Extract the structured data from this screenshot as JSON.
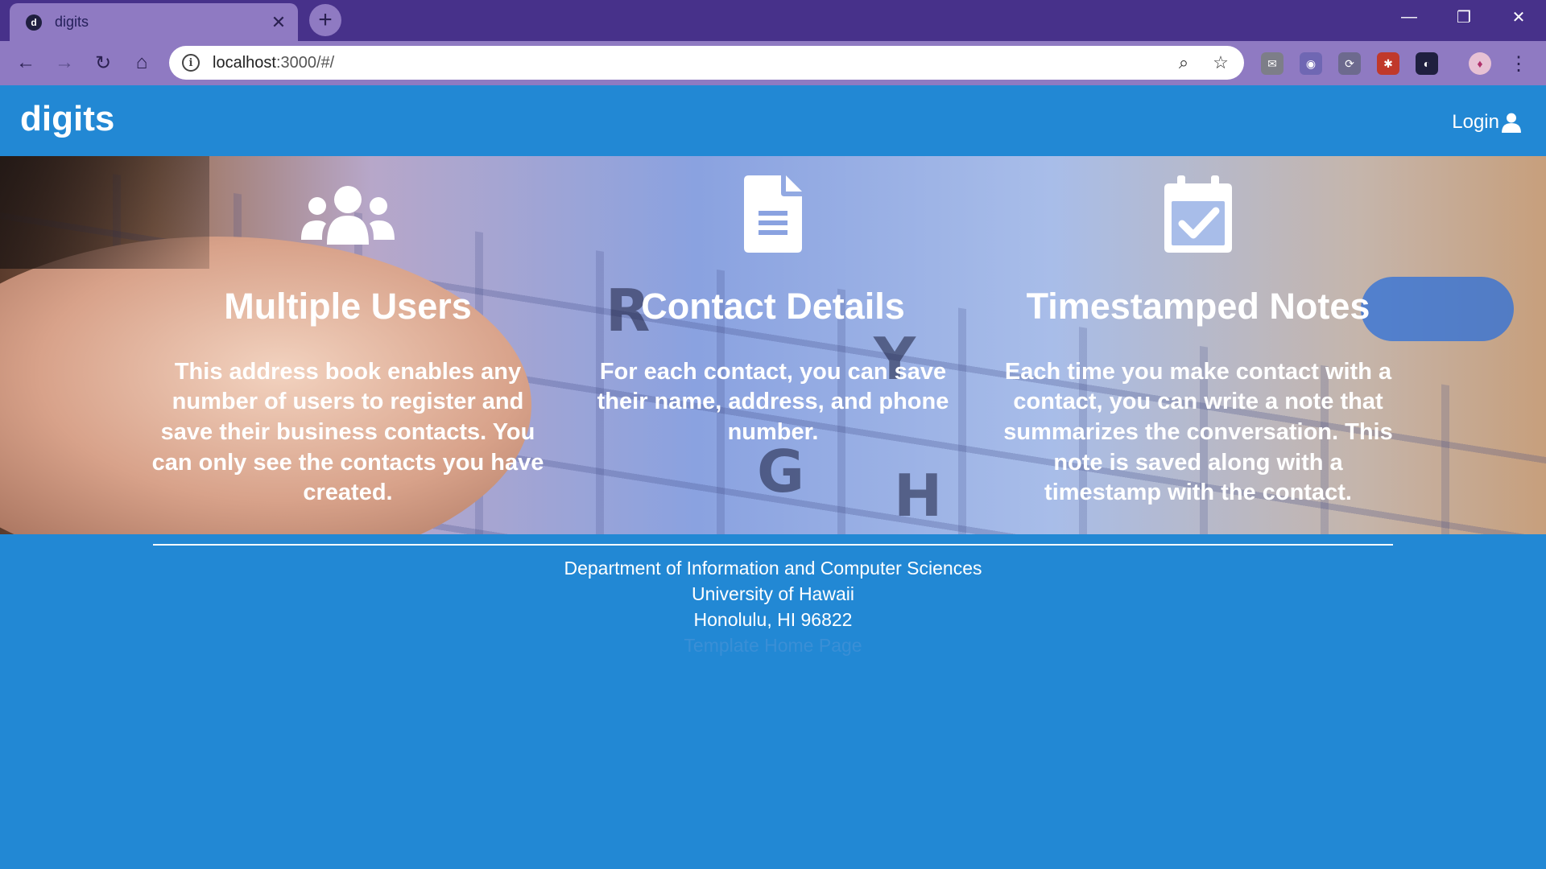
{
  "browser": {
    "tab_title": "digits",
    "url_host": "localhost",
    "url_path": ":3000/#/"
  },
  "navbar": {
    "brand": "digits",
    "login_label": "Login"
  },
  "features": [
    {
      "icon": "users-icon",
      "title": "Multiple Users",
      "description": "This address book enables any number of users to register and save their business contacts. You can only see the contacts you have created."
    },
    {
      "icon": "file-icon",
      "title": "Contact Details",
      "description": "For each contact, you can save their name, address, and phone number."
    },
    {
      "icon": "calendar-check-icon",
      "title": "Timestamped Notes",
      "description": "Each time you make contact with a contact, you can write a note that summarizes the conversation. This note is saved along with a timestamp with the contact."
    }
  ],
  "footer": {
    "line1": "Department of Information and Computer Sciences",
    "line2": "University of Hawaii",
    "line3": "Honolulu, HI 96822",
    "link_label": "Template Home Page"
  },
  "colors": {
    "browser_frame": "#47318a",
    "browser_toolbar": "#8f7ac2",
    "app_primary": "#2288d4"
  }
}
